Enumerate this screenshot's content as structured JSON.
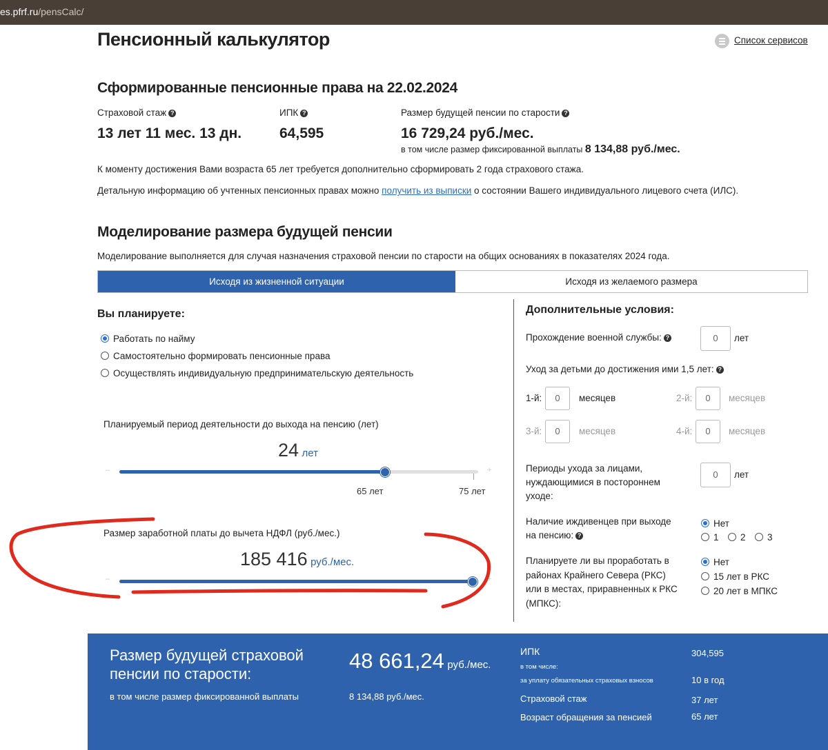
{
  "browser": {
    "url_host": "es.pfrf.ru",
    "url_path": "/pensCalc/"
  },
  "header": {
    "title": "Пенсионный калькулятор",
    "services_link": "Список сервисов"
  },
  "rights": {
    "title": "Сформированные пенсионные права на 22.02.2024",
    "stazh_label": "Страховой стаж",
    "stazh_value": "13 лет 11 мес. 13 дн.",
    "ipk_label": "ИПК",
    "ipk_value": "64,595",
    "pension_label": "Размер будущей пенсии по старости",
    "pension_value": "16 729,24 руб./мес.",
    "fixed_prefix": "в том числе размер фиксированной выплаты",
    "fixed_value": "8 134,88 руб./мес.",
    "note1": "К моменту достижения Вами возраста 65 лет требуется дополнительно сформировать 2 года страхового стажа.",
    "note2_before": "Детальную информацию об учтенных пенсионных правах можно",
    "note2_link": "получить из выписки",
    "note2_after": "о состоянии Вашего индивидуального лицевого счета (ИЛС)."
  },
  "modeling": {
    "title": "Моделирование размера будущей пенсии",
    "description": "Моделирование выполняется для случая назначения страховой пенсии по старости на общих основаниях в показателях 2024 года.",
    "tabs": [
      "Исходя из жизненной ситуации",
      "Исходя из желаемого размера"
    ]
  },
  "plan": {
    "title": "Вы планируете:",
    "options": [
      "Работать по найму",
      "Самостоятельно формировать пенсионные права",
      "Осуществлять индивидуальную предпринимательскую деятельность"
    ],
    "period_label": "Планируемый период деятельности до выхода на пенсию (лет)",
    "period_value": "24",
    "period_unit": "лет",
    "period_fraction": 0.74,
    "period_mark1": "65 лет",
    "period_mark2": "75 лет",
    "salary_label": "Размер заработной платы до вычета НДФЛ (руб./мес.)",
    "salary_value": "185 416",
    "salary_unit": "руб./мес.",
    "salary_fraction": 1.0,
    "minus": "–",
    "plus": "+"
  },
  "extra": {
    "title": "Дополнительные условия:",
    "military_label": "Прохождение военной службы:",
    "military_value": "0",
    "years": "лет",
    "childcare_label": "Уход за детьми до достижения ими 1,5 лет:",
    "child1": "1-й:",
    "child2": "2-й:",
    "child3": "3-й:",
    "child4": "4-й:",
    "child_value": "0",
    "months": "месяцев",
    "care_label_1": "Периоды ухода за лицами,",
    "care_label_2": "нуждающимися в постороннем",
    "care_label_3": "уходе:",
    "care_value": "0",
    "dependents_label_1": "Наличие иждивенцев при выходе",
    "dependents_label_2": "на пенсию:",
    "dependents_options": [
      "Нет",
      "1",
      "2",
      "3"
    ],
    "north_label_1": "Планируете ли вы проработать в",
    "north_label_2": "районах Крайнего Севера (РКС)",
    "north_label_3": "или в местах, приравненных к РКС",
    "north_label_4": "(МПКС):",
    "north_options": [
      "Нет",
      "15 лет в РКС",
      "20 лет в МПКС"
    ]
  },
  "summary": {
    "title_1": "Размер будущей страховой",
    "title_2": "пенсии по старости:",
    "amount": "48 661,24",
    "amount_unit": "руб./мес.",
    "fixed_label": "в том числе размер фиксированной выплаты",
    "fixed_value": "8 134,88 руб./мес.",
    "ipk_label": "ИПК",
    "ipk_value": "304,595",
    "incl_label": "в том числе:",
    "contrib_label": "за уплату обязательных страховых взносов",
    "contrib_value": "10 в год",
    "stazh_label": "Страховой стаж",
    "stazh_value": "37 лет",
    "age_label": "Возраст обращения за пенсией",
    "age_value": "65 лет"
  },
  "colors": {
    "accent": "#2e62ad",
    "annotation": "#e02a1e",
    "browser_bar": "#4a3f36"
  }
}
